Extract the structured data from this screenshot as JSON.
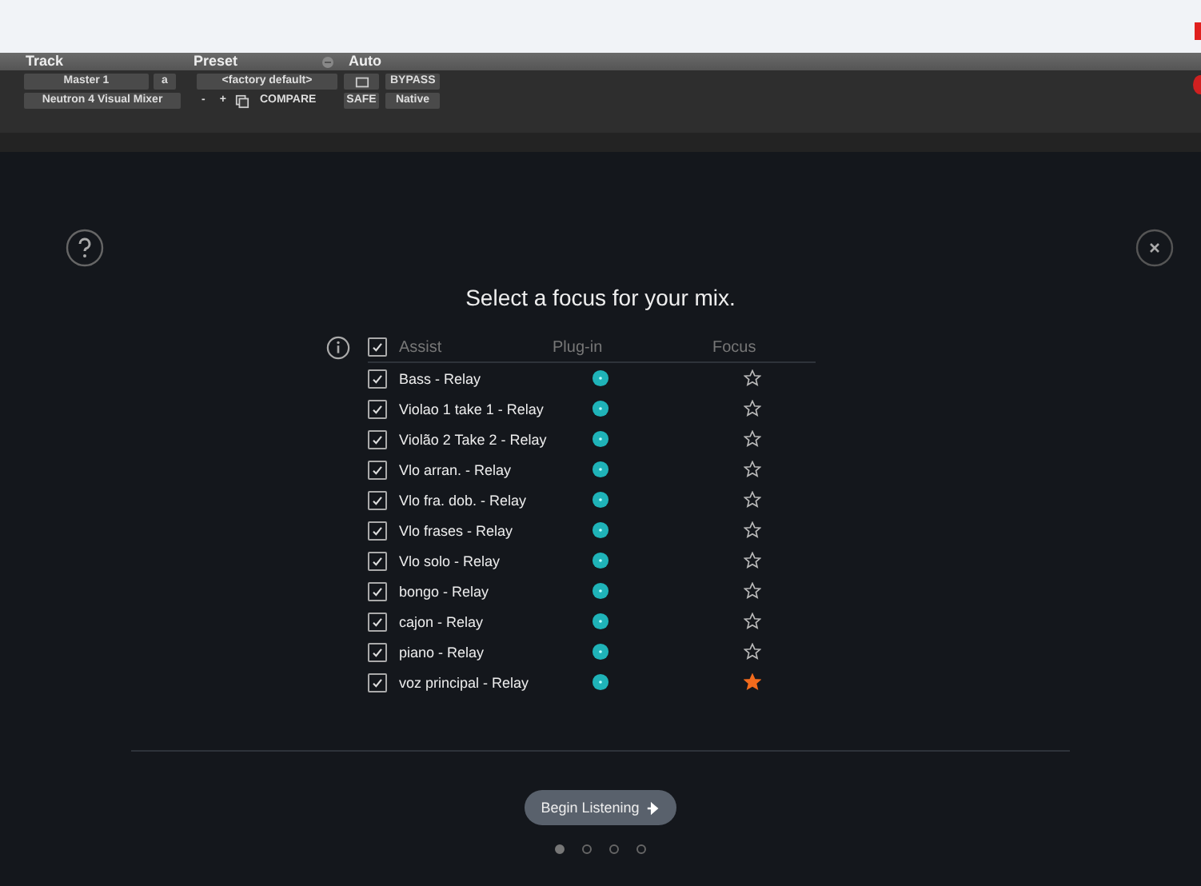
{
  "host_header": {
    "sections": [
      {
        "label": "Track"
      },
      {
        "label": "Preset"
      },
      {
        "label": "Auto"
      }
    ],
    "track": {
      "name": "Master 1",
      "slot": "a",
      "plugin": "Neutron 4 Visual Mixer"
    },
    "preset": {
      "name": "<factory default>",
      "minus": "-",
      "plus": "+",
      "compare": "COMPARE"
    },
    "auto": {
      "safe": "SAFE",
      "bypass": "BYPASS",
      "native": "Native"
    }
  },
  "title": "Select a focus for your mix.",
  "table": {
    "columns": [
      "Assist",
      "Plug-in",
      "Focus"
    ],
    "all_checked": true,
    "rows": [
      {
        "name": "Bass - Relay",
        "checked": true,
        "focus": false
      },
      {
        "name": "Violao 1 take 1 - Relay",
        "checked": true,
        "focus": false
      },
      {
        "name": "Violão 2 Take 2 - Relay",
        "checked": true,
        "focus": false
      },
      {
        "name": "Vlo arran. - Relay",
        "checked": true,
        "focus": false
      },
      {
        "name": "Vlo fra. dob. - Relay",
        "checked": true,
        "focus": false
      },
      {
        "name": "Vlo frases - Relay",
        "checked": true,
        "focus": false
      },
      {
        "name": "Vlo solo - Relay",
        "checked": true,
        "focus": false
      },
      {
        "name": "bongo - Relay",
        "checked": true,
        "focus": false
      },
      {
        "name": "cajon - Relay",
        "checked": true,
        "focus": false
      },
      {
        "name": "piano  - Relay",
        "checked": true,
        "focus": false
      },
      {
        "name": "voz principal - Relay",
        "checked": true,
        "focus": true
      }
    ]
  },
  "begin_button": "Begin Listening",
  "pages": [
    {
      "selected": true
    },
    {
      "selected": false
    },
    {
      "selected": false
    },
    {
      "selected": false
    }
  ]
}
